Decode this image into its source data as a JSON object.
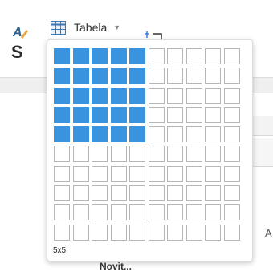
{
  "toolbar": {
    "left_icon": "font-color-icon",
    "left_letter": "S",
    "table_icon": "table-grid-icon",
    "table_label": "Tabela",
    "caret_icon": "caret-down-icon"
  },
  "table_picker": {
    "columns": 10,
    "rows": 10,
    "selected_columns": 5,
    "selected_rows": 5,
    "size_label": "5x5",
    "selected_color": "#3a93de",
    "cell_border_color": "#b6b6b6"
  },
  "background": {
    "bottom_text": "Novit..."
  }
}
